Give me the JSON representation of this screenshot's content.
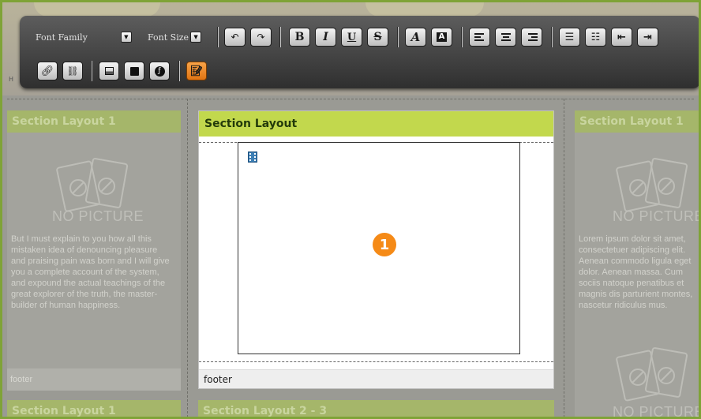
{
  "toolbar": {
    "font_family_label": "Font Family",
    "font_size_label": "Font Size",
    "dropdown_arrow": "▼",
    "bold": "B",
    "italic": "I",
    "underline": "U",
    "strike": "S",
    "accent_color": "#e98a1f"
  },
  "background": {
    "h_letter": "H"
  },
  "left_column": {
    "title": "Section Layout 1",
    "no_picture": "NO PICTURE",
    "text": "But I must explain to you how all this mistaken idea of denouncing pleasure and praising pain was born and I will give you a complete account of the system, and expound the actual teachings of the great explorer of the truth, the master-builder of human happiness.",
    "footer": "footer",
    "bottom_title": "Section Layout 1"
  },
  "center_section": {
    "title": "Section Layout",
    "badge": "1",
    "footer": "footer",
    "bottom_title": "Section Layout 2 - 3",
    "header_color": "#c2d84d",
    "badge_color": "#f58a17"
  },
  "right_column": {
    "title": "Section Layout 1",
    "no_picture": "NO PICTURE",
    "text": "Lorem ipsum dolor sit amet, consectetuer adipiscing elit. Aenean commodo ligula eget dolor. Aenean massa. Cum sociis natoque penatibus et magnis dis parturient montes, nascetur ridiculus mus.",
    "no_picture_bottom": "NO PICTURE"
  }
}
